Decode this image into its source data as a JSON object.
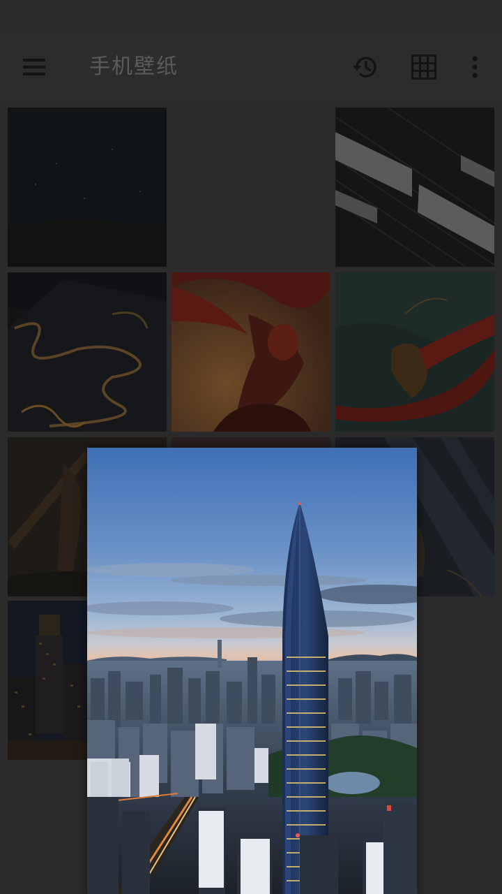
{
  "app": {
    "title": "手机壁纸"
  },
  "toolbar": {
    "menu_icon": "menu-icon",
    "history_icon": "history-icon",
    "grid_icon": "grid-view-icon",
    "more_icon": "more-vert-icon"
  },
  "colors": {
    "toolbar_bg": "#2c2c2c",
    "grid_bg": "#2b2b2b",
    "icon": "#141414",
    "title": "#5b5b5b"
  },
  "wallpapers": [
    {
      "subject": "night-sky-stars"
    },
    {
      "subject": "blank"
    },
    {
      "subject": "diagonal-wood-planks"
    },
    {
      "subject": "mountain-winding-road-night"
    },
    {
      "subject": "monkey-king-red-cape"
    },
    {
      "subject": "monkey-king-teal-sea"
    },
    {
      "subject": "warrior-with-staff"
    },
    {
      "subject": "dark-artwork"
    },
    {
      "subject": "light-rays-figure"
    },
    {
      "subject": "city-tower-night"
    }
  ],
  "preview": {
    "subject": "city-skyline-skyscraper-dusk"
  }
}
